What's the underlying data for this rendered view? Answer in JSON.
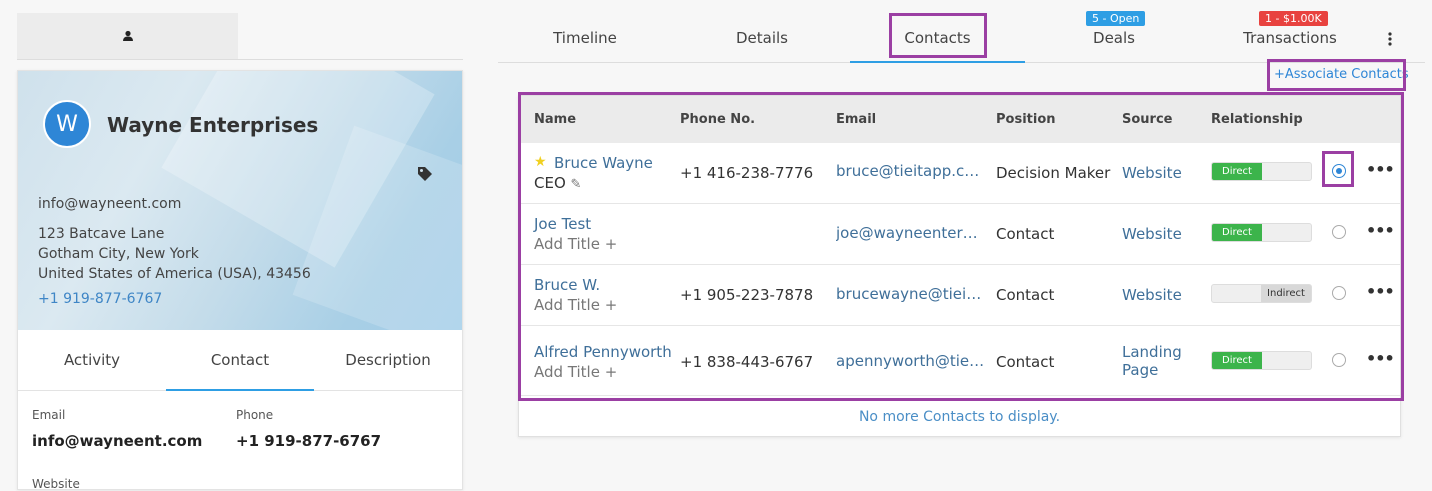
{
  "company": {
    "avatar_letter": "W",
    "name": "Wayne Enterprises",
    "email": "info@wayneent.com",
    "address1": "123 Batcave Lane",
    "address2": "Gotham City, New York",
    "address3": "United States of America (USA), 43456",
    "phone": "+1 919-877-6767"
  },
  "left_tabs": [
    "Activity",
    "Contact",
    "Description"
  ],
  "fields": {
    "email_label": "Email",
    "email_value": "info@wayneent.com",
    "phone_label": "Phone",
    "phone_value": "+1 919-877-6767",
    "website_label": "Website"
  },
  "tabs": {
    "timeline": "Timeline",
    "details": "Details",
    "contacts": "Contacts",
    "deals": "Deals",
    "deals_badge": "5 - Open",
    "transactions": "Transactions",
    "transactions_badge": "1 - $1.00K"
  },
  "associate_label": "+Associate Contacts",
  "table": {
    "headers": [
      "Name",
      "Phone No.",
      "Email",
      "Position",
      "Source",
      "Relationship"
    ],
    "rows": [
      {
        "name": "Bruce Wayne",
        "title": "CEO",
        "phone": "+1 416-238-7776",
        "email": "bruce@tieitapp.com",
        "position": "Decision Maker",
        "source": "Website",
        "relationship": "Direct"
      },
      {
        "name": "Joe Test",
        "title": "Add Title",
        "phone": "",
        "email": "joe@wayneenterpri...",
        "position": "Contact",
        "source": "Website",
        "relationship": "Direct"
      },
      {
        "name": "Bruce W.",
        "title": "Add Title",
        "phone": "+1 905-223-7878",
        "email": "brucewayne@tieita...",
        "position": "Contact",
        "source": "Website",
        "relationship": "Indirect"
      },
      {
        "name": "Alfred Pennyworth",
        "title": "Add Title",
        "phone": "+1 838-443-6767",
        "email": "apennyworth@tieit...",
        "position": "Contact",
        "source_line1": "Landing",
        "source_line2": "Page",
        "relationship": "Direct"
      }
    ],
    "footer": "No more Contacts to display."
  },
  "colors": {
    "accent": "#2e86d6",
    "highlight": "#9b3fa3",
    "direct": "#3cb44b",
    "deals_badge": "#2e9ee4",
    "transactions_badge": "#e8423f"
  }
}
